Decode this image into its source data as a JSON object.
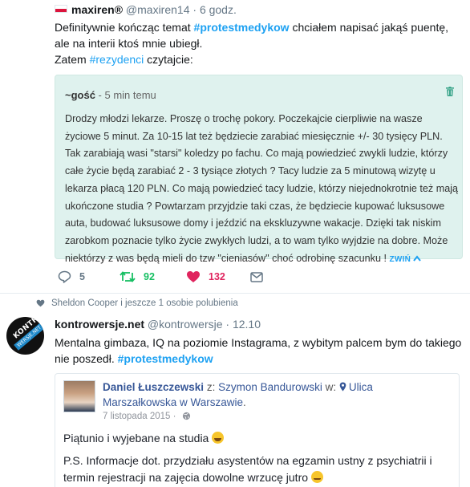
{
  "tweet1": {
    "flag": "poland-flag",
    "display_name": "maxiren®",
    "handle": "@maxiren14",
    "separator": "·",
    "time": "6 godz.",
    "text_line1_prefix": "Definitywnie kończąc temat ",
    "hashtag": "#protestmedykow",
    "text_line1_suffix": " chciałem napisać jakąś puentę, ale na interii ktoś mnie ubiegł.",
    "text_line2_prefix": "Zatem ",
    "hashtag2": "#rezydenci",
    "text_line2_suffix": " czytajcie:",
    "quote": {
      "author": "~gość",
      "time": " - 5 min temu",
      "body": "Drodzy młodzi lekarze. Proszę o trochę pokory. Poczekajcie cierpliwie na wasze życiowe 5 minut. Za 10-15 lat też będziecie zarabiać miesięcznie +/- 30 tysięcy PLN. Tak zarabiają wasi \"starsi\" koledzy po fachu. Co mają powiedzieć zwykli ludzie, którzy całe życie będą zarabiać 2 - 3 tysiące złotych ? Tacy ludzie za 5 minutową wizytę u lekarza płacą 120 PLN. Co mają powiedzieć tacy ludzie, którzy niejednokrotnie też mają ukończone studia ? Powtarzam przyjdzie taki czas, że będziecie kupować luksusowe auta, budować luksusowe domy i jeździć na ekskluzywne wakacje. Dzięki tak niskim zarobkom poznacie tylko życie zwykłych ludzi, a to wam tylko wyjdzie na dobre. Może niektórzy z was będą mieli do tzw \"cieniasów\" choć odrobinę szacunku ! ",
      "collapse_label": "ZWIŃ",
      "icon": "trash-icon",
      "bg_color": "#dff2ee"
    },
    "actions": {
      "replies": "5",
      "retweets": "92",
      "likes": "132",
      "retweet_color": "#17bf63",
      "like_color": "#e0245e"
    }
  },
  "tweet2": {
    "social_context": "Sheldon Cooper i jeszcze 1 osobie polubienia",
    "display_name": "kontrowersje.net",
    "handle": "@kontrowersje",
    "separator": "·",
    "time": "12.10",
    "avatar_text1": "KONTRO",
    "avatar_text2": "WERSJE.NET",
    "text_prefix": "Mentalna gimbaza, IQ na poziomie Instagrama, z wybitym palcem bym do takiego nie poszedł. ",
    "hashtag": "#protestmedykow",
    "fb_post": {
      "author": "Daniel Łuszczewski",
      "with_prefix": " z: ",
      "with_name": "Szymon Bandurowski",
      "in_prefix": " w: ",
      "place": "Ulica Marszałkowska w Warszawie",
      "place_suffix": ".",
      "date": "7 listopada 2015",
      "date_separator": " · ",
      "line1": "Piątunio i wyjebane na studia ",
      "line2": "P.S. Informacje dot. przydziału asystentów na egzamin ustny z psychiatrii i termin rejestracji na zajęcia dowolne wrzucę jutro "
    }
  }
}
